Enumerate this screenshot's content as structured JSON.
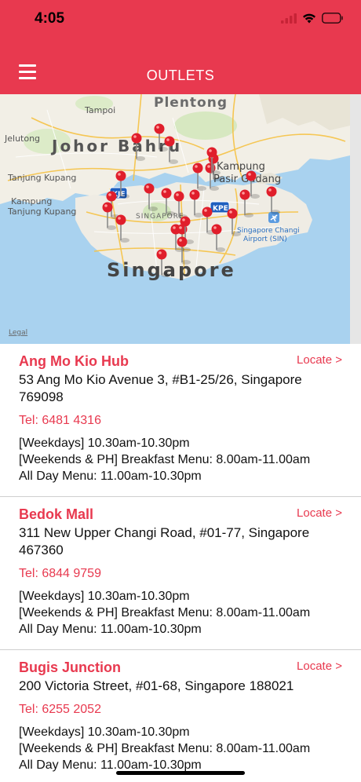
{
  "status": {
    "time": "4:05"
  },
  "header": {
    "title": "OUTLETS",
    "menu_icon": "hamburger-menu-icon"
  },
  "map": {
    "labels": {
      "plentong": "Plentong",
      "tampoi": "Tampoi",
      "jelutong": "Jelutong",
      "johor_bahru": "Johor Bahru",
      "kampung": "Kampung",
      "pasir_gudang": "Pasir Gudang",
      "tanjung_kupang": "Tanjung Kupang",
      "kampung_tanjung_kupang": "Kampung",
      "kampung_tanjung_kupang_2": "Tanjung Kupang",
      "singapore_small": "SINGAPORE",
      "singapore": "Singapore",
      "changi": "Singapore Changi",
      "changi_2": "Airport (SIN)",
      "kpe": "KPE",
      "kje": "KJE",
      "legal": "Legal"
    },
    "pin_count": 26
  },
  "outlets": [
    {
      "name": "Ang Mo Kio Hub",
      "locate": "Locate >",
      "address": "53 Ang Mo Kio Avenue 3, #B1-25/26, Singapore 769098",
      "tel": "Tel: 6481 4316",
      "hours": [
        "[Weekdays] 10.30am-10.30pm",
        "[Weekends & PH] Breakfast Menu: 8.00am-11.00am",
        "All Day Menu: 11.00am-10.30pm"
      ]
    },
    {
      "name": "Bedok Mall",
      "locate": "Locate >",
      "address": "311 New Upper Changi Road, #01-77, Singapore 467360",
      "tel": "Tel: 6844 9759",
      "hours": [
        "[Weekdays] 10.30am-10.30pm",
        "[Weekends & PH] Breakfast Menu: 8.00am-11.00am",
        "All Day Menu: 11.00am-10.30pm"
      ]
    },
    {
      "name": "Bugis Junction",
      "locate": "Locate >",
      "address": "200 Victoria Street, #01-68, Singapore 188021",
      "tel": "Tel: 6255 2052",
      "hours": [
        "[Weekdays] 10.30am-10.30pm",
        "[Weekends & PH] Breakfast Menu: 8.00am-11.00am",
        "All Day Menu: 11.00am-10.30pm"
      ]
    }
  ],
  "colors": {
    "brand": "#e8394f",
    "water": "#a9d2ef",
    "land": "#f2efe6",
    "pin": "#e01e2b"
  }
}
